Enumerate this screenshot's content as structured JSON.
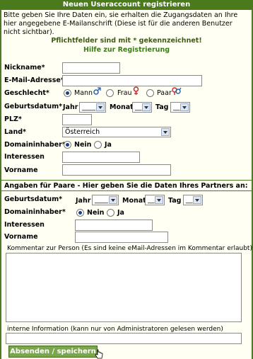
{
  "title": "Neuen Useraccount registrieren",
  "intro": "Bitte geben Sie Ihre Daten ein, sie erhalten die Zugangsdaten an Ihre hier angegebene E-Mailanschrift (Diese ist für die anderen Benutzer nicht sichtbar).",
  "required_note": "Pflichtfelder sind mit * gekennzeichnet!",
  "help_link": "Hilfe zur Registrierung",
  "fields": {
    "nickname": "Nickname*",
    "email": "E-Mail-Adresse*",
    "gender": "Geschlecht*",
    "gender_male": "Mann",
    "gender_female": "Frau",
    "gender_couple": "Paar",
    "birthdate": "Geburtsdatum*",
    "year": "Jahr",
    "month": "Monat",
    "day": "Tag",
    "year_value": "____",
    "month_value": "__",
    "day_value": "__",
    "plz": "PLZ*",
    "country": "Land*",
    "country_value": "Österreich",
    "domain_owner": "Domaininhaber*",
    "no": "Nein",
    "yes": "Ja",
    "interests": "Interessen",
    "firstname": "Vorname"
  },
  "partner": {
    "heading": "Angaben für Paare - Hier geben Sie die Daten Ihres Partners an:",
    "birthdate": "Geburtsdatum*",
    "year": "Jahr",
    "month": "Monat",
    "day": "Tag",
    "year_value": "____",
    "month_value": "__",
    "day_value": "__",
    "domain_owner": "Domaininhaber*",
    "no": "Nein",
    "yes": "Ja",
    "interests": "Interessen",
    "firstname": "Vorname",
    "comment_label": "Kommentar zur Person (Es sind keine eMail-Adressen im Kommentar erlaubt)*",
    "internal_label": "interne Information (kann nur von Administratoren gelesen werden)"
  },
  "submit": "Absenden / speichern",
  "colors": {
    "accent": "#4a7a1c",
    "male": "#2a5fb0",
    "female": "#c0282d"
  }
}
